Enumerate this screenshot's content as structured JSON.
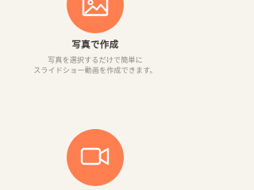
{
  "features": [
    {
      "icon": "photo-icon",
      "title": "写真で作成",
      "description_lines": [
        "写真を選択するだけで簡単に",
        "スライドショー動画を作成できます。"
      ]
    },
    {
      "icon": "video-camera-icon"
    }
  ],
  "colors": {
    "background": "#f7f4ee",
    "accent": "#ff7f50",
    "title_text": "#3a3836",
    "description_text": "#8a8784",
    "icon_stroke": "#ffffff"
  }
}
